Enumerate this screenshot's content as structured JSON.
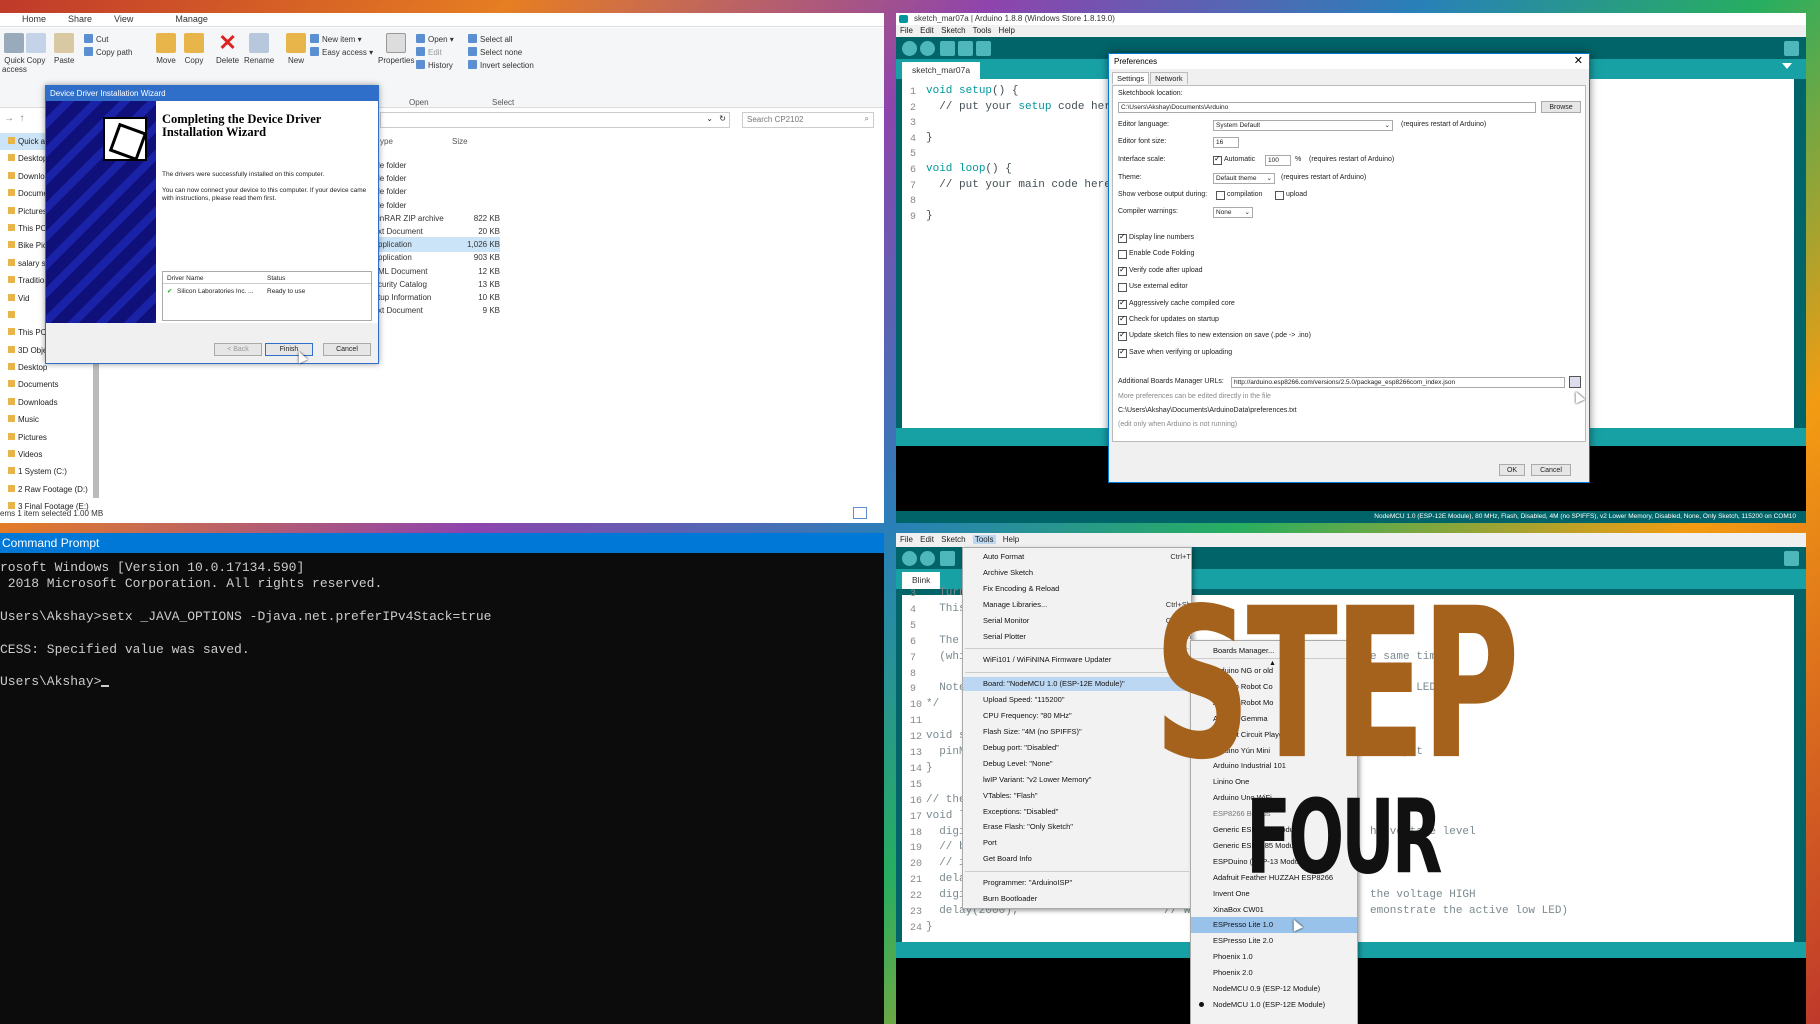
{
  "explorer": {
    "tabs": [
      "Home",
      "Share",
      "View",
      "Manage"
    ],
    "ribbon": {
      "quick": "Quick\naccess",
      "copy": "Copy",
      "paste": "Paste",
      "cut": "Cut",
      "copy_path": "Copy path",
      "move": "Move",
      "copy2": "Copy",
      "delete": "Delete",
      "rename": "Rename",
      "new": "New",
      "new_item": "New item ▾",
      "easy_access": "Easy access ▾",
      "properties": "Properties",
      "open": "Open ▾",
      "edit": "Edit",
      "history": "History",
      "select_all": "Select all",
      "select_none": "Select none",
      "invert": "Invert selection",
      "g_open": "Open",
      "g_select": "Select"
    },
    "search_placeholder": "Search CP2102",
    "col_type": "ype",
    "col_size": "Size",
    "nav": [
      "Quick acces",
      "Desktop",
      "Downloa",
      "Documen",
      "Pictures",
      "This PC",
      "Bike Pics",
      "salary slip",
      "Traditiona",
      "Vid",
      "",
      "This PC",
      "3D Object",
      "Desktop",
      "Documents",
      "Downloads",
      "Music",
      "Pictures",
      "Videos",
      "1 System (C:)",
      "2 Raw Footage (D:)",
      "3 Final Footage (E:)"
    ],
    "files": [
      {
        "type": "le folder",
        "size": ""
      },
      {
        "type": "le folder",
        "size": ""
      },
      {
        "type": "le folder",
        "size": ""
      },
      {
        "type": "le folder",
        "size": ""
      },
      {
        "type": "inRAR ZIP archive",
        "size": "822 KB"
      },
      {
        "type": "xt Document",
        "size": "20 KB"
      },
      {
        "type": "pplication",
        "size": "1,026 KB"
      },
      {
        "type": "pplication",
        "size": "903 KB"
      },
      {
        "type": "ML Document",
        "size": "12 KB"
      },
      {
        "type": "curity Catalog",
        "size": "13 KB"
      },
      {
        "type": "tup Information",
        "size": "10 KB"
      },
      {
        "type": "xt Document",
        "size": "9 KB"
      }
    ],
    "status": "ems    1 item selected  1.00 MB"
  },
  "wizard": {
    "title": "Device Driver Installation Wizard",
    "heading": "Completing the Device Driver Installation Wizard",
    "p1": "The drivers were successfully installed on this computer.",
    "p2": "You can now connect your device to this computer. If your device came with instructions, please read them first.",
    "col_driver": "Driver Name",
    "col_status": "Status",
    "driver": "Silicon Laboratories Inc. ...",
    "driver_status": "Ready to use",
    "back": "< Back",
    "finish": "Finish",
    "cancel": "Cancel"
  },
  "ard1": {
    "title": "sketch_mar07a | Arduino 1.8.8 (Windows Store 1.8.19.0)",
    "menu": "File Edit Sketch Tools Help",
    "tab": "sketch_mar07a",
    "lines": [
      "1",
      "2",
      "3",
      "4",
      "5",
      "6",
      "7",
      "8",
      "9"
    ],
    "code": [
      "void setup() {",
      "  // put your setup code here",
      "",
      "}",
      "",
      "void loop() {",
      "  // put your main code here",
      "",
      "}"
    ],
    "footer": "NodeMCU 1.0 (ESP-12E Module), 80 MHz, Flash, Disabled, 4M (no SPIFFS), v2 Lower Memory, Disabled, None, Only Sketch, 115200 on COM10"
  },
  "prefs": {
    "title": "Preferences",
    "tab_settings": "Settings",
    "tab_network": "Network",
    "sketchbook_label": "Sketchbook location:",
    "sketchbook": "C:\\Users\\Akshay\\Documents\\Arduino",
    "browse": "Browse",
    "lang_label": "Editor language:",
    "lang": "System Default",
    "lang_note": "(requires restart of Arduino)",
    "font_label": "Editor font size:",
    "font": "16",
    "scale_label": "Interface scale:",
    "automatic": "Automatic",
    "scale": "100",
    "pct": "%",
    "scale_note": "(requires restart of Arduino)",
    "theme_label": "Theme:",
    "theme": "Default theme",
    "theme_note": "(requires restart of Arduino)",
    "verbose_label": "Show verbose output during:",
    "compilation": "compilation",
    "upload": "upload",
    "warn_label": "Compiler warnings:",
    "warn": "None",
    "checks": [
      {
        "label": "Display line numbers",
        "on": true
      },
      {
        "label": "Enable Code Folding",
        "on": false
      },
      {
        "label": "Verify code after upload",
        "on": true
      },
      {
        "label": "Use external editor",
        "on": false
      },
      {
        "label": "Aggressively cache compiled core",
        "on": true
      },
      {
        "label": "Check for updates on startup",
        "on": true
      },
      {
        "label": "Update sketch files to new extension on save (.pde -> .ino)",
        "on": true
      },
      {
        "label": "Save when verifying or uploading",
        "on": true
      }
    ],
    "urls_label": "Additional Boards Manager URLs:",
    "urls": "http://arduino.esp8266.com/versions/2.5.0/package_esp8266com_index.json",
    "more": "More preferences can be edited directly in the file",
    "path": "C:\\Users\\Akshay\\Documents\\ArduinoData\\preferences.txt",
    "edit_note": "(edit only when Arduino is not running)",
    "ok": "OK",
    "cancel": "Cancel"
  },
  "cmd": {
    "title": "Command Prompt",
    "lines": [
      "rosoft Windows [Version 10.0.17134.590]",
      " 2018 Microsoft Corporation. All rights reserved.",
      "",
      "Users\\Akshay>setx _JAVA_OPTIONS -Djava.net.preferIPv4Stack=true",
      "",
      "CESS: Specified value was saved.",
      "",
      "Users\\Akshay>"
    ]
  },
  "ard2": {
    "menu": "File Edit Sketch Tools Help",
    "tab": "Blink",
    "lines": [
      "3",
      "4",
      "5",
      "6",
      "7",
      "8",
      "9",
      "10",
      "11",
      "12",
      "13",
      "14",
      "15",
      "16",
      "17",
      "18",
      "19",
      "20",
      "21",
      "22",
      "23",
      "24"
    ],
    "code": [
      "  Turn",
      "  This",
      "",
      "  The",
      "  (whi",
      "",
      "  Note",
      "*/",
      "",
      "void se",
      "  pinMo",
      "}",
      "",
      "// the",
      "void lo",
      "  digit",
      "  // bu",
      "  // it",
      "  delay",
      "  digit",
      "  delay(2000);",
      "}"
    ],
    "code_right": [
      "",
      "",
      "",
      "",
      "e same tim",
      "",
      "ternal LED",
      "",
      "",
      "",
      "n output",
      "",
      "",
      "",
      "",
      "he voltage level",
      "",
      "",
      "",
      "the voltage HIGH",
      "emonstrate the active low LED)",
      ""
    ],
    "comment23": "// Wa",
    "tools": [
      {
        "label": "Auto Format",
        "sc": "Ctrl+T"
      },
      {
        "label": "Archive Sketch",
        "sc": ""
      },
      {
        "label": "Fix Encoding & Reload",
        "sc": ""
      },
      {
        "label": "Manage Libraries...",
        "sc": "Ctrl+Sh"
      },
      {
        "label": "Serial Monitor",
        "sc": "Ctrl+Sh"
      },
      {
        "label": "Serial Plotter",
        "sc": "Ctrl+Sh"
      },
      {
        "label": "WiFi101 / WiFiNINA Firmware Updater",
        "sc": ""
      },
      {
        "label": "Board: \"NodeMCU 1.0 (ESP-12E Module)\"",
        "sc": ""
      },
      {
        "label": "Upload Speed: \"115200\"",
        "sc": ""
      },
      {
        "label": "CPU Frequency: \"80 MHz\"",
        "sc": ""
      },
      {
        "label": "Flash Size: \"4M (no SPIFFS)\"",
        "sc": ""
      },
      {
        "label": "Debug port: \"Disabled\"",
        "sc": ""
      },
      {
        "label": "Debug Level: \"None\"",
        "sc": ""
      },
      {
        "label": "lwIP Variant: \"v2 Lower Memory\"",
        "sc": ""
      },
      {
        "label": "VTables: \"Flash\"",
        "sc": ""
      },
      {
        "label": "Exceptions: \"Disabled\"",
        "sc": ""
      },
      {
        "label": "Erase Flash: \"Only Sketch\"",
        "sc": ""
      },
      {
        "label": "Port",
        "sc": ""
      },
      {
        "label": "Get Board Info",
        "sc": ""
      },
      {
        "label": "Programmer: \"ArduinoISP\"",
        "sc": ""
      },
      {
        "label": "Burn Bootloader",
        "sc": ""
      }
    ],
    "boards": [
      "Boards Manager...",
      "▲",
      "Arduino NG or old",
      "Arduino Robot Co",
      "Arduino Robot Mo",
      "Arduino Gemma",
      "Adafruit Circuit Playground",
      "Arduino Yún Mini",
      "Arduino Industrial 101",
      "Linino One",
      "Arduino Uno WiFi",
      "ESP8266 Boards",
      "Generic ESP8266 Module",
      "Generic ESP8285 Module",
      "ESPDuino (ESP-13 Module)",
      "Adafruit Feather HUZZAH ESP8266",
      "Invent One",
      "XinaBox CW01",
      "ESPresso Lite 1.0",
      "ESPresso Lite 2.0",
      "Phoenix 1.0",
      "Phoenix 2.0",
      "NodeMCU 0.9 (ESP-12 Module)",
      "NodeMCU 1.0 (ESP-12E Module)"
    ]
  },
  "overlay": {
    "step": "STEP",
    "four": "FOUR"
  },
  "colors": {
    "arduino_teal": "#006468",
    "arduino_bar": "#17a1a5",
    "step": "#a4621c",
    "win_blue": "#0078d7"
  }
}
